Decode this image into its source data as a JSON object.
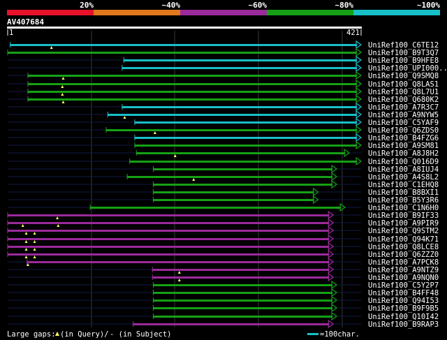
{
  "legend": {
    "labels": [
      "20%",
      "~40%",
      "~60%",
      "~80%",
      "~100%"
    ],
    "colors": [
      "#e8112a",
      "#e0781c",
      "#9b2a9b",
      "#16a016",
      "#18c0c8"
    ]
  },
  "query": {
    "title": "AV407684",
    "start_label": "1",
    "end_label": "421",
    "length": 421
  },
  "hits": [
    {
      "name": "UniRef100_C6TE12",
      "color": "#18c0c8",
      "start": 4,
      "end": 421,
      "query_gaps": [
        53
      ],
      "subject_gaps": []
    },
    {
      "name": "UniRef100_B9T3Q7",
      "color": "#16a016",
      "start": 1,
      "end": 421,
      "query_gaps": [],
      "subject_gaps": []
    },
    {
      "name": "UniRef100_B9HFE8",
      "color": "#18c0c8",
      "start": 139,
      "end": 421,
      "query_gaps": [],
      "subject_gaps": []
    },
    {
      "name": "UniRef100_UPI000...",
      "color": "#18c0c8",
      "start": 137,
      "end": 421,
      "query_gaps": [],
      "subject_gaps": []
    },
    {
      "name": "UniRef100_Q9SMQ8",
      "color": "#16a016",
      "start": 25,
      "end": 421,
      "query_gaps": [
        67
      ],
      "subject_gaps": []
    },
    {
      "name": "UniRef100_Q8LAS1",
      "color": "#16a016",
      "start": 25,
      "end": 421,
      "query_gaps": [
        66
      ],
      "subject_gaps": []
    },
    {
      "name": "UniRef100_Q8L7U1",
      "color": "#16a016",
      "start": 25,
      "end": 421,
      "query_gaps": [
        66
      ],
      "subject_gaps": []
    },
    {
      "name": "UniRef100_Q680K2",
      "color": "#16a016",
      "start": 25,
      "end": 421,
      "query_gaps": [
        67
      ],
      "subject_gaps": []
    },
    {
      "name": "UniRef100_A7R3C7",
      "color": "#18c0c8",
      "start": 137,
      "end": 421,
      "query_gaps": [],
      "subject_gaps": []
    },
    {
      "name": "UniRef100_A9NYW5",
      "color": "#18c0c8",
      "start": 120,
      "end": 421,
      "query_gaps": [
        140
      ],
      "subject_gaps": []
    },
    {
      "name": "UniRef100_C5YAF9",
      "color": "#18c0c8",
      "start": 152,
      "end": 421,
      "query_gaps": [],
      "subject_gaps": []
    },
    {
      "name": "UniRef100_Q6ZDS0",
      "color": "#16a016",
      "start": 118,
      "end": 421,
      "query_gaps": [
        176
      ],
      "subject_gaps": []
    },
    {
      "name": "UniRef100_B4FZG6",
      "color": "#18c0c8",
      "start": 152,
      "end": 421,
      "query_gaps": [],
      "subject_gaps": []
    },
    {
      "name": "UniRef100_A9SM81",
      "color": "#16a016",
      "start": 152,
      "end": 421,
      "query_gaps": [],
      "subject_gaps": []
    },
    {
      "name": "UniRef100_A8J8H2",
      "color": "#16a016",
      "start": 154,
      "end": 407,
      "query_gaps": [
        200
      ],
      "subject_gaps": []
    },
    {
      "name": "UniRef100_Q016D9",
      "color": "#16a016",
      "start": 146,
      "end": 421,
      "query_gaps": [],
      "subject_gaps": []
    },
    {
      "name": "UniRef100_A8IUJ4",
      "color": "#16a016",
      "start": 174,
      "end": 392,
      "query_gaps": [],
      "subject_gaps": []
    },
    {
      "name": "UniRef100_A4S8L2",
      "color": "#16a016",
      "start": 143,
      "end": 392,
      "query_gaps": [
        222
      ],
      "subject_gaps": []
    },
    {
      "name": "UniRef100_C1EHQ8",
      "color": "#16a016",
      "start": 174,
      "end": 392,
      "query_gaps": [],
      "subject_gaps": []
    },
    {
      "name": "UniRef100_B8BXI1",
      "color": "#16a016",
      "start": 174,
      "end": 370,
      "query_gaps": [],
      "subject_gaps": []
    },
    {
      "name": "UniRef100_B5Y3R6",
      "color": "#16a016",
      "start": 174,
      "end": 370,
      "query_gaps": [],
      "subject_gaps": []
    },
    {
      "name": "UniRef100_C1N6H0",
      "color": "#16a016",
      "start": 99,
      "end": 402,
      "query_gaps": [],
      "subject_gaps": []
    },
    {
      "name": "UniRef100_B9IF33",
      "color": "#9b2a9b",
      "start": 1,
      "end": 388,
      "query_gaps": [
        60
      ],
      "subject_gaps": []
    },
    {
      "name": "UniRef100_A9PIR9",
      "color": "#9b2a9b",
      "start": 1,
      "end": 388,
      "query_gaps": [
        19,
        61
      ],
      "subject_gaps": []
    },
    {
      "name": "UniRef100_Q9STM2",
      "color": "#9b2a9b",
      "start": 1,
      "end": 388,
      "query_gaps": [
        23,
        33
      ],
      "subject_gaps": []
    },
    {
      "name": "UniRef100_Q94K71",
      "color": "#9b2a9b",
      "start": 1,
      "end": 388,
      "query_gaps": [
        23,
        33
      ],
      "subject_gaps": []
    },
    {
      "name": "UniRef100_Q8LCE8",
      "color": "#9b2a9b",
      "start": 1,
      "end": 388,
      "query_gaps": [
        23,
        33
      ],
      "subject_gaps": []
    },
    {
      "name": "UniRef100_Q6ZZZ0",
      "color": "#9b2a9b",
      "start": 1,
      "end": 388,
      "query_gaps": [
        23,
        33
      ],
      "subject_gaps": []
    },
    {
      "name": "UniRef100_A7PCK8",
      "color": "#9b2a9b",
      "start": 24,
      "end": 388,
      "query_gaps": [
        25
      ],
      "subject_gaps": []
    },
    {
      "name": "UniRef100_A9NTZ9",
      "color": "#9b2a9b",
      "start": 173,
      "end": 388,
      "query_gaps": [
        205
      ],
      "subject_gaps": []
    },
    {
      "name": "UniRef100_A9NQN0",
      "color": "#9b2a9b",
      "start": 173,
      "end": 388,
      "query_gaps": [
        205
      ],
      "subject_gaps": []
    },
    {
      "name": "UniRef100_C5Y2P7",
      "color": "#16a016",
      "start": 174,
      "end": 392,
      "query_gaps": [],
      "subject_gaps": []
    },
    {
      "name": "UniRef100_B4FF48",
      "color": "#16a016",
      "start": 174,
      "end": 392,
      "query_gaps": [],
      "subject_gaps": []
    },
    {
      "name": "UniRef100_Q94I53",
      "color": "#16a016",
      "start": 174,
      "end": 392,
      "query_gaps": [],
      "subject_gaps": []
    },
    {
      "name": "UniRef100_B9F9B5",
      "color": "#16a016",
      "start": 174,
      "end": 392,
      "query_gaps": [],
      "subject_gaps": []
    },
    {
      "name": "UniRef100_Q10I42",
      "color": "#16a016",
      "start": 174,
      "end": 392,
      "query_gaps": [],
      "subject_gaps": []
    },
    {
      "name": "UniRef100_B9RAP3",
      "color": "#9b2a9b",
      "start": 150,
      "end": 388,
      "query_gaps": [],
      "subject_gaps": []
    }
  ],
  "footer": {
    "gaps_prefix": "Large gaps: ",
    "gaps_query": "(in Query)/",
    "gaps_subject": "- (in Subject)",
    "scale_label": "=100char."
  }
}
